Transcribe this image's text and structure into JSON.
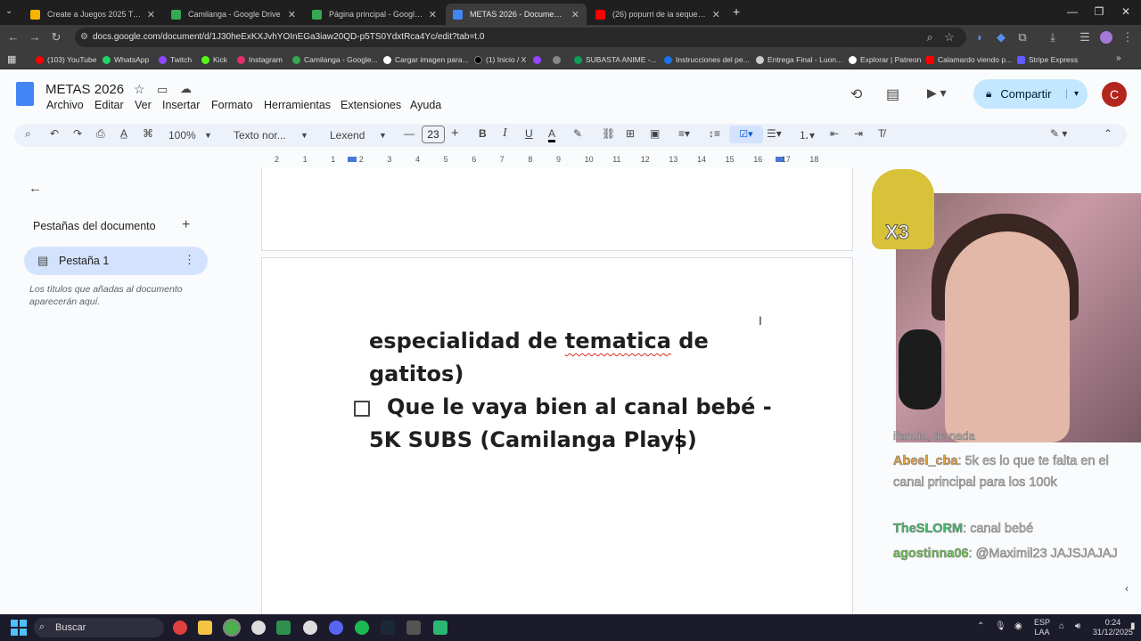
{
  "browser": {
    "tabs": [
      {
        "label": "Create a Juegos 2025 Tier List -",
        "color": "#f4b400"
      },
      {
        "label": "Camilanga - Google Drive",
        "color": "#34a853"
      },
      {
        "label": "Página principal - Google Drive",
        "color": "#34a853"
      },
      {
        "label": "METAS 2026 - Documentos de",
        "color": "#4285f4",
        "active": true
      },
      {
        "label": "(26) popurri de ia seque un rio",
        "color": "#ff0000"
      }
    ],
    "url": "docs.google.com/document/d/1J30heExKXJvhYOInEGa3iaw20QD-p5TS0YdxtRca4Yc/edit?tab=t.0",
    "bookmarks": [
      {
        "label": "(103) YouTube",
        "color": "#ff0000"
      },
      {
        "label": "WhatsApp",
        "color": "#25d366"
      },
      {
        "label": "Twitch",
        "color": "#9146ff"
      },
      {
        "label": "Kick",
        "color": "#53fc18"
      },
      {
        "label": "Instagram",
        "color": "#e1306c"
      },
      {
        "label": "Camilanga - Google...",
        "color": "#34a853"
      },
      {
        "label": "Cargar imagen para...",
        "color": "#ffffff"
      },
      {
        "label": "(1) Inicio / X",
        "color": "#000000"
      },
      {
        "label": "",
        "color": "#9146ff"
      },
      {
        "label": "",
        "color": "#888888"
      },
      {
        "label": "SUBASTA ANIME -...",
        "color": "#0f9d58"
      },
      {
        "label": "Instrucciones del pe...",
        "color": "#1a73e8"
      },
      {
        "label": "Entrega Final - Luon...",
        "color": "#cccccc"
      },
      {
        "label": "Explorar | Patreon",
        "color": "#ffffff"
      },
      {
        "label": "Calamardo viendo p...",
        "color": "#ff0000"
      },
      {
        "label": "Stripe Express",
        "color": "#635bff"
      }
    ]
  },
  "docs": {
    "title": "METAS 2026",
    "menus": [
      "Archivo",
      "Editar",
      "Ver",
      "Insertar",
      "Formato",
      "Herramientas",
      "Extensiones",
      "Ayuda"
    ],
    "share_label": "Compartir",
    "avatar_letter": "C",
    "toolbar": {
      "zoom": "100%",
      "style": "Texto nor...",
      "font": "Lexend",
      "font_size": "23"
    },
    "ruler_numbers": [
      "2",
      "1",
      "1",
      "2",
      "3",
      "4",
      "5",
      "6",
      "7",
      "8",
      "9",
      "10",
      "11",
      "12",
      "13",
      "14",
      "15",
      "16",
      "17",
      "18"
    ],
    "sidebar": {
      "title": "Pestañas del documento",
      "tab_label": "Pestaña 1",
      "hint": "Los títulos que añadas al documento aparecerán aquí."
    },
    "content": {
      "line1_pre": "especialidad de ",
      "line1_mis": "tematica",
      "line1_post": " de",
      "line2": "gatitos)",
      "line3": "Que le vaya bien al canal bebé -",
      "line4": "5K SUBS (Camilanga Plays)"
    }
  },
  "stream": {
    "emote_text": "X3",
    "chat": [
      {
        "user": "",
        "user_color": "#ffffff",
        "text": "ifanuis, de nada"
      },
      {
        "user": "Abeel_cba",
        "user_color": "#e8a23c",
        "text": ": 5k es lo que te falta en el canal principal para los 100k"
      },
      {
        "user": "TheSLORM",
        "user_color": "#3cc36b",
        "text": ": canal bebé"
      },
      {
        "user": "agostinna06",
        "user_color": "#66cc44",
        "text": ": @Maximil23 JAJSJAJAJ"
      }
    ]
  },
  "taskbar": {
    "search_label": "Buscar",
    "lang": "ESP",
    "lang2": "LAA",
    "time": "0:24",
    "date": "31/12/2025"
  }
}
